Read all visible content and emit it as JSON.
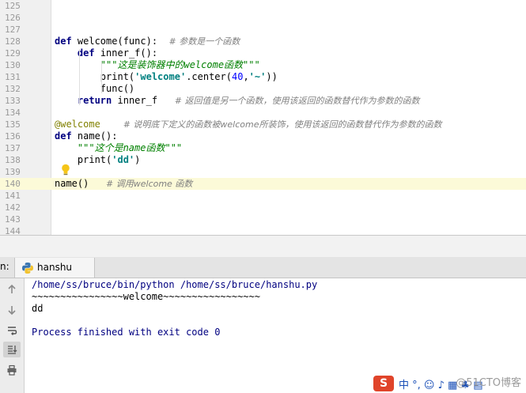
{
  "editor": {
    "lines": [
      {
        "n": "125",
        "current": false,
        "tokens": []
      },
      {
        "n": "126",
        "current": false,
        "tokens": []
      },
      {
        "n": "127",
        "current": false,
        "tokens": []
      },
      {
        "n": "128",
        "current": false,
        "tokens": [
          {
            "t": "kw",
            "v": "def"
          },
          {
            "t": "p",
            "v": " welcome(func):  "
          },
          {
            "t": "cmt",
            "v": "# 参数是一个函数"
          }
        ]
      },
      {
        "n": "129",
        "current": false,
        "tokens": [
          {
            "t": "p",
            "v": "    "
          },
          {
            "t": "kw",
            "v": "def"
          },
          {
            "t": "p",
            "v": " inner_f():"
          }
        ]
      },
      {
        "n": "130",
        "current": false,
        "tokens": [
          {
            "t": "p",
            "v": "        "
          },
          {
            "t": "doc",
            "v": "\"\"\"这是装饰器中的welcome函数\"\"\""
          }
        ]
      },
      {
        "n": "131",
        "current": false,
        "tokens": [
          {
            "t": "p",
            "v": "        print("
          },
          {
            "t": "str",
            "v": "'welcome'"
          },
          {
            "t": "p",
            "v": ".center("
          },
          {
            "t": "num",
            "v": "40"
          },
          {
            "t": "p",
            "v": ","
          },
          {
            "t": "str",
            "v": "'~'"
          },
          {
            "t": "p",
            "v": "))"
          }
        ]
      },
      {
        "n": "132",
        "current": false,
        "tokens": [
          {
            "t": "p",
            "v": "        func()"
          }
        ]
      },
      {
        "n": "133",
        "current": false,
        "tokens": [
          {
            "t": "p",
            "v": "    "
          },
          {
            "t": "kw",
            "v": "return"
          },
          {
            "t": "p",
            "v": " inner_f   "
          },
          {
            "t": "cmt",
            "v": "# 返回值是另一个函数，使用该返回的函数替代作为参数的函数"
          }
        ]
      },
      {
        "n": "134",
        "current": false,
        "tokens": []
      },
      {
        "n": "135",
        "current": false,
        "tokens": [
          {
            "t": "deco",
            "v": "@welcome"
          },
          {
            "t": "p",
            "v": "    "
          },
          {
            "t": "cmt",
            "v": "# 说明底下定义的函数被welcome所装饰，使用该返回的函数替代作为参数的函数"
          }
        ]
      },
      {
        "n": "136",
        "current": false,
        "tokens": [
          {
            "t": "kw",
            "v": "def"
          },
          {
            "t": "p",
            "v": " name():"
          }
        ]
      },
      {
        "n": "137",
        "current": false,
        "tokens": [
          {
            "t": "p",
            "v": "    "
          },
          {
            "t": "doc",
            "v": "\"\"\"这个是name函数\"\"\""
          }
        ]
      },
      {
        "n": "138",
        "current": false,
        "tokens": [
          {
            "t": "p",
            "v": "    print("
          },
          {
            "t": "str",
            "v": "'dd'"
          },
          {
            "t": "p",
            "v": ")"
          }
        ]
      },
      {
        "n": "139",
        "current": false,
        "tokens": []
      },
      {
        "n": "140",
        "current": true,
        "tokens": [
          {
            "t": "p",
            "v": "name()   "
          },
          {
            "t": "cmt",
            "v": "# 调用welcome 函数"
          }
        ]
      },
      {
        "n": "141",
        "current": false,
        "tokens": []
      },
      {
        "n": "142",
        "current": false,
        "tokens": []
      },
      {
        "n": "143",
        "current": false,
        "tokens": []
      },
      {
        "n": "144",
        "current": false,
        "tokens": []
      }
    ]
  },
  "run_panel": {
    "prefix": "n:",
    "tab_label": "hanshu",
    "tab_icon": "python-icon",
    "toolbar": [
      "up-arrow-icon",
      "down-arrow-icon",
      "soft-wrap-icon",
      "scroll-to-end-icon",
      "print-icon"
    ],
    "console": [
      {
        "cls": "c-cmd",
        "text": "/home/ss/bruce/bin/python /home/ss/bruce/hanshu.py"
      },
      {
        "cls": "c-out",
        "text": "~~~~~~~~~~~~~~~~welcome~~~~~~~~~~~~~~~~~"
      },
      {
        "cls": "c-out",
        "text": "dd"
      },
      {
        "cls": "c-out",
        "text": ""
      },
      {
        "cls": "c-exit",
        "text": "Process finished with exit code 0"
      }
    ]
  },
  "overlay": {
    "ime_logo": "S",
    "ime_chars": "中 °, ☺ ♪ ▦ ♣ ▤",
    "watermark": "@51CTO博客"
  },
  "colors": {
    "keyword": "#000080",
    "string": "#008080",
    "docstring": "#008000",
    "comment": "#808080",
    "decorator": "#808000",
    "current_line": "#fcfad8"
  }
}
